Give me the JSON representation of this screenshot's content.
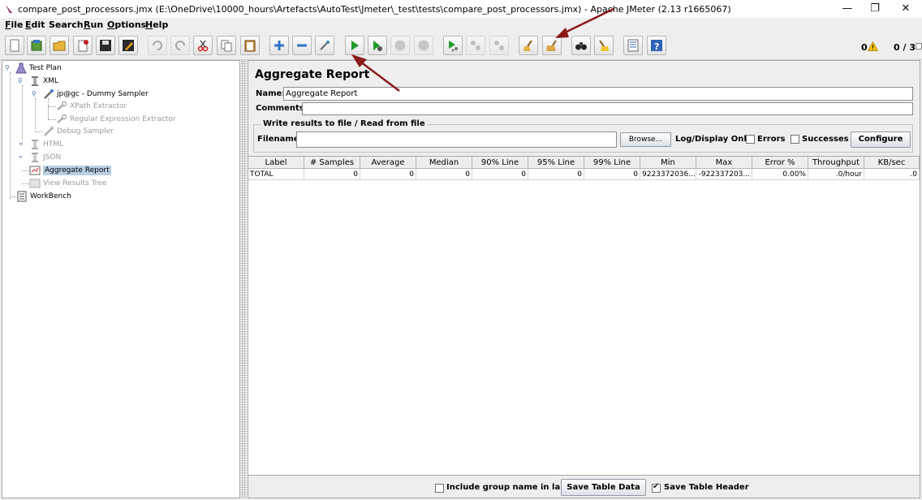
{
  "window": {
    "title": "compare_post_processors.jmx (E:\\OneDrive\\10000_hours\\Artefacts\\AutoTest\\Jmeter\\_test\\tests\\compare_post_processors.jmx) - Apache JMeter (2.13 r1665067)",
    "minimize": "—",
    "restore": "❐",
    "close": "✕"
  },
  "menu": [
    {
      "first": "F",
      "rest": "ile"
    },
    {
      "first": "E",
      "rest": "dit"
    },
    {
      "first": "",
      "rest": "Search"
    },
    {
      "first": "R",
      "rest": "un"
    },
    {
      "first": "O",
      "rest": "ptions"
    },
    {
      "first": "H",
      "rest": "elp"
    }
  ],
  "toolbar": {
    "error_count": "0",
    "thread_count": "0 / 3"
  },
  "tree": {
    "test_plan": "Test Plan",
    "xml": "XML",
    "dummy_sampler": "jp@gc - Dummy Sampler",
    "xpath_extractor": "XPath Extractor",
    "regex_extractor": "Regular Expression Extractor",
    "debug_sampler": "Debug Sampler",
    "html": "HTML",
    "json": "JSON",
    "aggregate_report": "Aggregate Report",
    "view_results_tree": "View Results Tree",
    "workbench": "WorkBench"
  },
  "report": {
    "title": "Aggregate Report",
    "name_label": "Name:",
    "name_value": "Aggregate Report",
    "comments_label": "Comments:",
    "comments_value": "",
    "group_title": "Write results to file / Read from file",
    "filename_label": "Filename",
    "filename_value": "",
    "browse": "Browse...",
    "log_display_only": "Log/Display Only:",
    "errors": "Errors",
    "successes": "Successes",
    "configure": "Configure"
  },
  "table": {
    "headers": [
      "Label",
      "# Samples",
      "Average",
      "Median",
      "90% Line",
      "95% Line",
      "99% Line",
      "Min",
      "Max",
      "Error %",
      "Throughput",
      "KB/sec"
    ],
    "rows": [
      [
        "TOTAL",
        "0",
        "0",
        "0",
        "0",
        "0",
        "0",
        "9223372036...",
        "-922337203...",
        "0.00%",
        ".0/hour",
        ".0"
      ]
    ]
  },
  "footer": {
    "include_group": "Include group name in label?",
    "save_table_data": "Save Table Data",
    "save_table_header": "Save Table Header"
  },
  "colors": {
    "selection": "#b8cfe5",
    "annotation_arrow": "#8b1a1a",
    "run_green": "#1f9a2a"
  }
}
